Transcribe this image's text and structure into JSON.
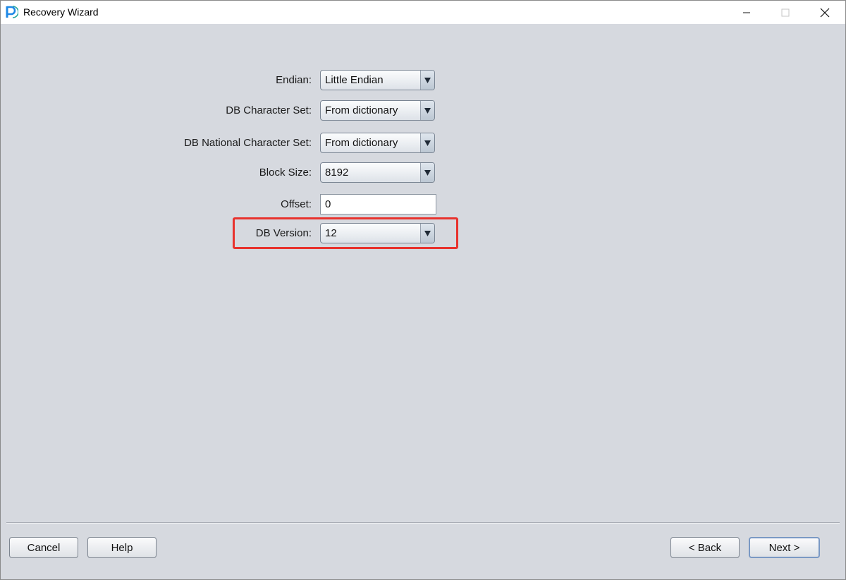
{
  "window": {
    "title": "Recovery Wizard",
    "app_icon": "p-logo-icon"
  },
  "window_controls": {
    "minimize_icon": "minimize-icon",
    "maximize_icon": "maximize-icon",
    "close_icon": "close-icon"
  },
  "form": {
    "endian": {
      "label": "Endian:",
      "value": "Little Endian"
    },
    "db_character_set": {
      "label": "DB Character Set:",
      "value": "From dictionary"
    },
    "db_national_character_set": {
      "label": "DB National Character Set:",
      "value": "From dictionary"
    },
    "block_size": {
      "label": "Block Size:",
      "value": "8192"
    },
    "offset": {
      "label": "Offset:",
      "value": "0"
    },
    "db_version": {
      "label": "DB Version:",
      "value": "12"
    }
  },
  "buttons": {
    "cancel": "Cancel",
    "help": "Help",
    "back": "< Back",
    "next": "Next >"
  },
  "colors": {
    "highlight": "#e8322d",
    "background": "#d6d9df",
    "app_icon_blue": "#1e88e5"
  }
}
